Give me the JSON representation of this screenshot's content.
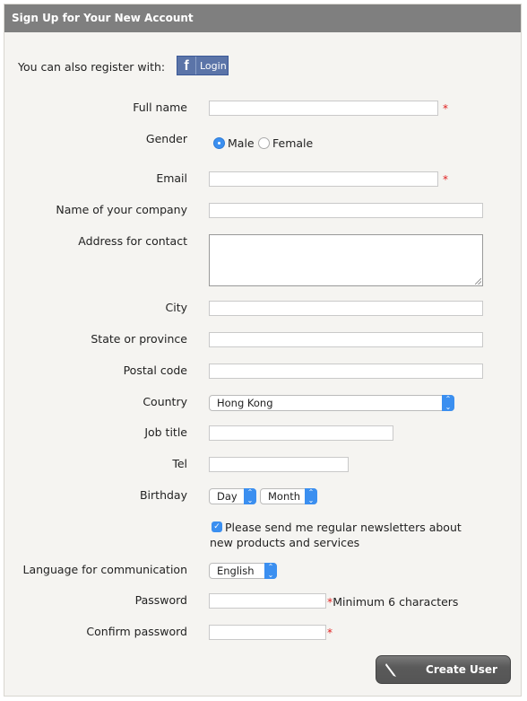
{
  "header": {
    "title": "Sign Up for Your New Account"
  },
  "social": {
    "label": "You can also register with:",
    "facebook_icon": "f",
    "facebook_button": "Login"
  },
  "fields": {
    "full_name": {
      "label": "Full name",
      "value": "",
      "required": "*"
    },
    "gender": {
      "label": "Gender",
      "options": [
        "Male",
        "Female"
      ],
      "selected": "Male"
    },
    "email": {
      "label": "Email",
      "value": "",
      "required": "*"
    },
    "company": {
      "label": "Name of your company",
      "value": ""
    },
    "address": {
      "label": "Address for contact",
      "value": ""
    },
    "city": {
      "label": "City",
      "value": ""
    },
    "state": {
      "label": "State or province",
      "value": ""
    },
    "postal": {
      "label": "Postal code",
      "value": ""
    },
    "country": {
      "label": "Country",
      "value": "Hong Kong"
    },
    "job_title": {
      "label": "Job title",
      "value": ""
    },
    "tel": {
      "label": "Tel",
      "value": ""
    },
    "birthday": {
      "label": "Birthday",
      "day": "Day",
      "month": "Month"
    },
    "newsletter": {
      "text": "Please send me regular newsletters about new products and services",
      "checked": true
    },
    "language": {
      "label": "Language for communication",
      "value": "English"
    },
    "password": {
      "label": "Password",
      "required": "*",
      "hint": "Minimum 6 characters"
    },
    "confirm_password": {
      "label": "Confirm password",
      "required": "*"
    }
  },
  "submit": {
    "label": "Create User"
  },
  "icons": {
    "select_arrow": "⌃⌄",
    "check": "✓"
  }
}
